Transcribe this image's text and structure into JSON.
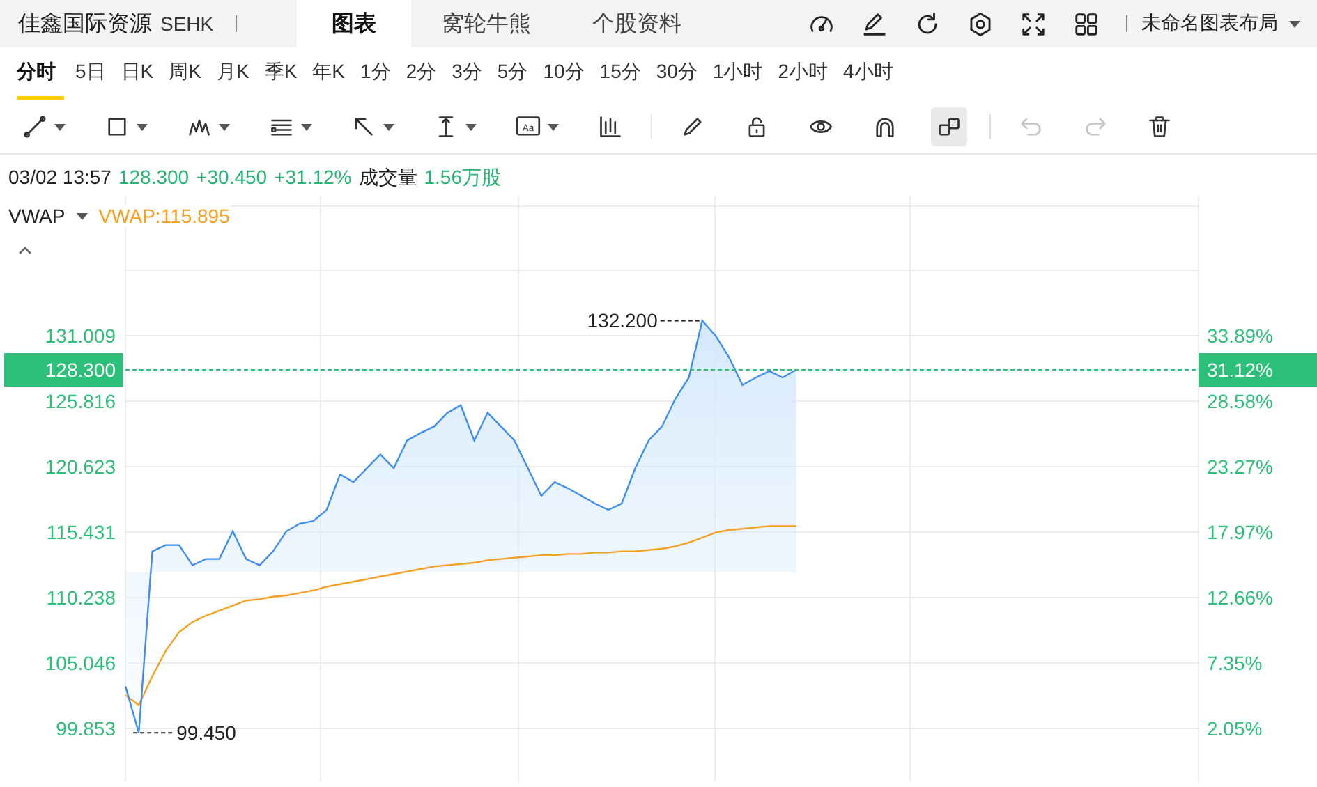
{
  "header": {
    "title": "佳鑫国际资源",
    "exchange": "SEHK",
    "layout_name": "未命名图表布局",
    "tabs": [
      {
        "label": "图表",
        "selected": true
      },
      {
        "label": "窝轮牛熊",
        "selected": false
      },
      {
        "label": "个股资料",
        "selected": false
      }
    ],
    "actions": [
      {
        "kind": "gauge"
      },
      {
        "kind": "edit"
      },
      {
        "kind": "refresh"
      },
      {
        "kind": "settings"
      },
      {
        "kind": "fullscreen"
      },
      {
        "kind": "grid"
      }
    ]
  },
  "periods": [
    {
      "label": "分时",
      "selected": true
    },
    {
      "label": "5日",
      "selected": false
    },
    {
      "label": "日K",
      "selected": false
    },
    {
      "label": "周K",
      "selected": false
    },
    {
      "label": "月K",
      "selected": false
    },
    {
      "label": "季K",
      "selected": false
    },
    {
      "label": "年K",
      "selected": false
    },
    {
      "label": "1分",
      "selected": false
    },
    {
      "label": "2分",
      "selected": false
    },
    {
      "label": "3分",
      "selected": false
    },
    {
      "label": "5分",
      "selected": false
    },
    {
      "label": "10分",
      "selected": false
    },
    {
      "label": "15分",
      "selected": false
    },
    {
      "label": "30分",
      "selected": false
    },
    {
      "label": "1小时",
      "selected": false
    },
    {
      "label": "2小时",
      "selected": false
    },
    {
      "label": "4小时",
      "selected": false
    }
  ],
  "toolbar": [
    {
      "tools": [
        {
          "kind": "line",
          "has_menu": true,
          "selected": false,
          "disabled": false
        },
        {
          "kind": "rectangle",
          "has_menu": true,
          "selected": false,
          "disabled": false
        },
        {
          "kind": "wave",
          "has_menu": true,
          "selected": false,
          "disabled": false
        },
        {
          "kind": "lines",
          "has_menu": true,
          "selected": false,
          "disabled": false
        },
        {
          "kind": "arrow",
          "has_menu": true,
          "selected": false,
          "disabled": false
        },
        {
          "kind": "measure",
          "has_menu": true,
          "selected": false,
          "disabled": false
        },
        {
          "kind": "text",
          "label": "Aa",
          "has_menu": true,
          "selected": false,
          "disabled": false
        },
        {
          "kind": "candles",
          "has_menu": false,
          "selected": false,
          "disabled": false
        }
      ]
    },
    {
      "tools": [
        {
          "kind": "pencil",
          "has_menu": false,
          "selected": false,
          "disabled": false
        },
        {
          "kind": "lock",
          "has_menu": false,
          "selected": false,
          "disabled": false
        },
        {
          "kind": "eye",
          "has_menu": false,
          "selected": false,
          "disabled": false
        },
        {
          "kind": "magnet",
          "has_menu": false,
          "selected": false,
          "disabled": false
        },
        {
          "kind": "link",
          "has_menu": false,
          "selected": true,
          "disabled": false
        }
      ]
    },
    {
      "tools": [
        {
          "kind": "undo",
          "has_menu": false,
          "selected": false,
          "disabled": true
        },
        {
          "kind": "redo",
          "has_menu": false,
          "selected": false,
          "disabled": true
        },
        {
          "kind": "trash",
          "has_menu": false,
          "selected": false,
          "disabled": false
        }
      ]
    }
  ],
  "quote": {
    "datetime": "03/02 13:57",
    "price": "128.300",
    "change": "+30.450",
    "change_pct": "+31.12%",
    "volume_label": "成交量",
    "volume": "1.56万股"
  },
  "indicator": {
    "value": "VWAP:115.895"
  },
  "chart": {
    "last_price_tag": "128.300",
    "last_percent_tag": "31.12%",
    "high_label": "132.200",
    "low_label": "99.450",
    "percent_axis_labels": [
      "33.89%",
      "28.58%",
      "23.27%",
      "17.97%",
      "12.66%",
      "7.35%",
      "2.05%"
    ],
    "chart_data": {
      "type": "line",
      "ylim": [
        95.65,
        142.06
      ],
      "grid": true,
      "ref_lines": [
        {
          "axis": "y",
          "value": 128.3,
          "color": "#2cbf7a"
        }
      ],
      "categories": [
        null,
        null,
        null,
        null,
        null,
        null,
        null,
        null,
        null,
        null,
        null,
        null,
        null,
        null,
        null,
        null,
        null,
        null,
        null,
        null,
        null,
        null,
        null,
        null,
        null,
        null,
        null,
        null,
        null,
        null,
        null,
        null,
        null,
        null,
        null,
        null,
        null,
        null,
        null,
        null,
        null,
        null,
        null,
        null,
        null,
        null,
        null,
        null,
        null,
        null,
        null,
        null,
        null,
        null,
        null,
        null,
        null,
        null,
        null,
        null,
        null,
        null,
        null,
        null,
        null,
        null,
        null,
        null,
        null,
        null,
        null,
        null,
        null,
        null,
        null,
        null,
        null,
        null,
        null,
        null,
        null
      ],
      "series": [
        {
          "color": "#3d8ef0",
          "values": [
            103.2,
            99.5,
            113.9,
            114.4,
            114.4,
            112.8,
            113.3,
            113.3,
            115.5,
            113.3,
            112.8,
            113.9,
            115.5,
            116.1,
            116.3,
            117.2,
            120.0,
            119.4,
            120.5,
            121.6,
            120.5,
            122.7,
            123.3,
            123.8,
            124.9,
            125.5,
            122.7,
            124.9,
            123.8,
            122.7,
            120.5,
            118.3,
            119.4,
            118.9,
            118.3,
            117.7,
            117.2,
            117.7,
            120.5,
            122.7,
            123.8,
            126.0,
            127.7,
            132.2,
            131.0,
            129.3,
            127.1,
            127.7,
            128.2,
            127.7,
            128.3,
            null,
            null,
            null,
            null,
            null,
            null,
            null,
            null,
            null,
            null,
            null,
            null,
            null,
            null,
            null,
            null,
            null,
            null,
            null,
            null,
            null,
            null,
            null,
            null,
            null,
            null,
            null,
            null,
            null,
            null
          ]
        },
        {
          "name": "VWAP",
          "color": "#f5a020",
          "values": [
            102.5,
            101.7,
            104.0,
            106.0,
            107.5,
            108.3,
            108.8,
            109.2,
            109.6,
            110.0,
            110.1,
            110.3,
            110.4,
            110.6,
            110.8,
            111.1,
            111.3,
            111.5,
            111.7,
            111.9,
            112.1,
            112.3,
            112.5,
            112.7,
            112.8,
            112.9,
            113.0,
            113.2,
            113.3,
            113.4,
            113.5,
            113.6,
            113.6,
            113.7,
            113.7,
            113.8,
            113.8,
            113.9,
            113.9,
            114.0,
            114.1,
            114.3,
            114.6,
            115.0,
            115.4,
            115.6,
            115.7,
            115.8,
            115.9,
            115.9,
            115.9,
            null,
            null,
            null,
            null,
            null,
            null,
            null,
            null,
            null,
            null,
            null,
            null,
            null,
            null,
            null,
            null,
            null,
            null,
            null,
            null,
            null,
            null,
            null,
            null,
            null,
            null,
            null,
            null,
            null,
            null
          ]
        }
      ],
      "yticks": [
        {
          "value": 131.009,
          "label": "131.009"
        },
        {
          "value": 125.816,
          "label": "125.816"
        },
        {
          "value": 120.623,
          "label": "120.623"
        },
        {
          "value": 115.431,
          "label": "115.431"
        },
        {
          "value": 110.238,
          "label": "110.238"
        },
        {
          "value": 105.046,
          "label": "105.046"
        },
        {
          "value": 99.853,
          "label": "99.853"
        }
      ]
    }
  }
}
